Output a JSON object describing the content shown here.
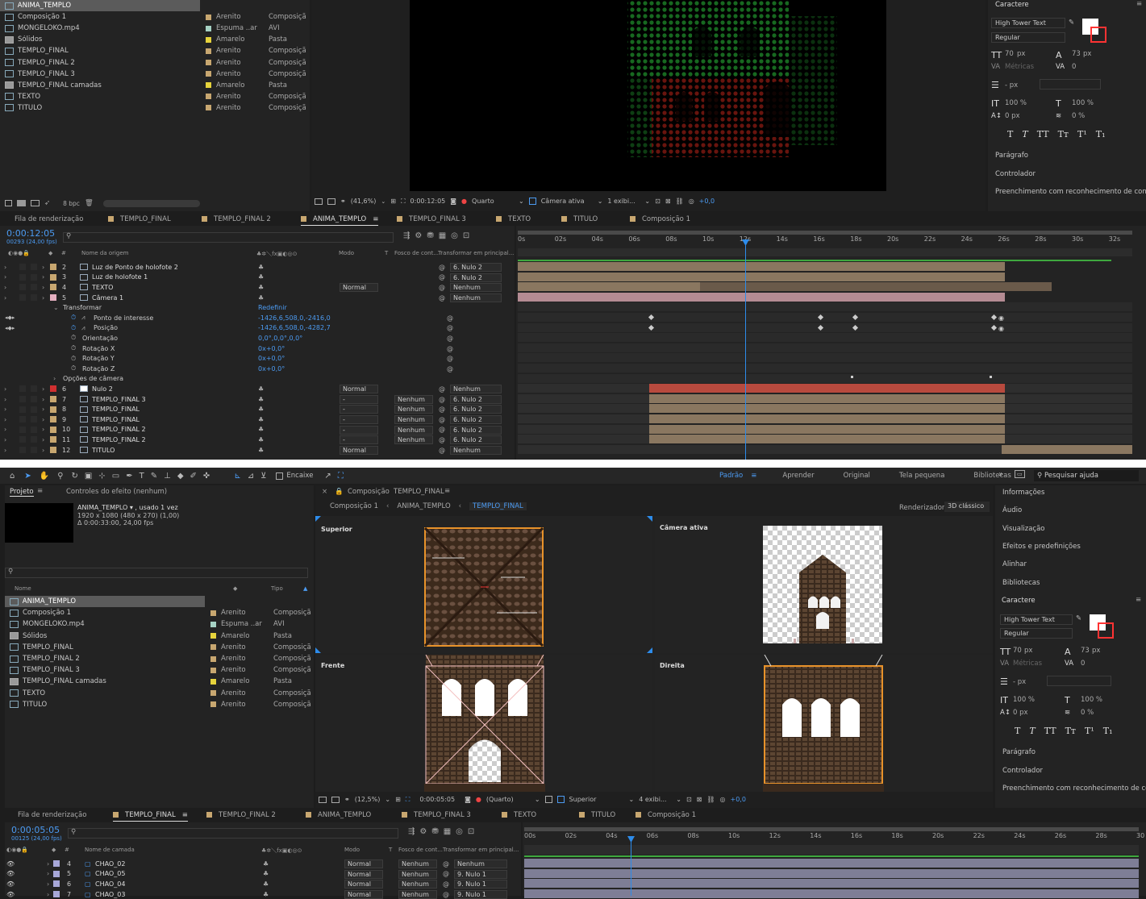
{
  "top": {
    "project_items": [
      {
        "name": "ANIMA_TEMPLO",
        "color_name": "Arenito",
        "type": "Composiçã",
        "color": "#c8a770",
        "icon": "comp-icon",
        "selected": true
      },
      {
        "name": "Composição 1",
        "color_name": "Arenito",
        "type": "Composiçã",
        "color": "#c8a770",
        "icon": "comp-icon"
      },
      {
        "name": "MONGELOKO.mp4",
        "color_name": "Espuma ..ar",
        "type": "AVI",
        "color": "#a6d2c4",
        "icon": "video-file-icon"
      },
      {
        "name": "Sólidos",
        "color_name": "Amarelo",
        "type": "Pasta",
        "color": "#e6d33c",
        "icon": "folder-icon"
      },
      {
        "name": "TEMPLO_FINAL",
        "color_name": "Arenito",
        "type": "Composiçã",
        "color": "#c8a770",
        "icon": "comp-icon"
      },
      {
        "name": "TEMPLO_FINAL 2",
        "color_name": "Arenito",
        "type": "Composiçã",
        "color": "#c8a770",
        "icon": "comp-icon"
      },
      {
        "name": "TEMPLO_FINAL 3",
        "color_name": "Arenito",
        "type": "Composiçã",
        "color": "#c8a770",
        "icon": "comp-icon"
      },
      {
        "name": "TEMPLO_FINAL camadas",
        "color_name": "Amarelo",
        "type": "Pasta",
        "color": "#e6d33c",
        "icon": "folder-icon"
      },
      {
        "name": "TEXTO",
        "color_name": "Arenito",
        "type": "Composiçã",
        "color": "#c8a770",
        "icon": "comp-icon"
      },
      {
        "name": "TITULO",
        "color_name": "Arenito",
        "type": "Composiçã",
        "color": "#c8a770",
        "icon": "comp-icon"
      }
    ],
    "bpc": "8 bpc",
    "viewer_bar": {
      "zoom": "(41,6%)",
      "timecode": "0:00:12:05",
      "resolution": "Quarto",
      "camera": "Câmera ativa",
      "views": "1 exibi...",
      "exposure": "+0,0"
    },
    "character": {
      "title": "Caractere",
      "font": "High Tower Text",
      "style": "Regular",
      "size": "70",
      "size_unit": "px",
      "leading": "73",
      "leading_unit": "px",
      "kerning": "Métricas",
      "tracking": "0",
      "line_unit": "- px",
      "vscale": "100 %",
      "hscale": "100 %",
      "baseline": "0 px",
      "tsume": "0 %"
    },
    "side_panels": [
      "Parágrafo",
      "Controlador",
      "Preenchimento com reconhecimento de conteú"
    ],
    "tabs": [
      "Fila de renderização",
      "TEMPLO_FINAL",
      "TEMPLO_FINAL 2",
      "ANIMA_TEMPLO",
      "TEMPLO_FINAL 3",
      "TEXTO",
      "TITULO",
      "Composição 1"
    ],
    "active_tab": "ANIMA_TEMPLO",
    "timecode": "0:00:12:05",
    "frames": "00293 (24,00 fps)",
    "col_headers": {
      "source": "Nome da origem",
      "mode": "Modo",
      "t": "T",
      "track": "Fosco de cont...",
      "parent": "Transformar em principal..."
    },
    "ruler": [
      "0s",
      "02s",
      "04s",
      "06s",
      "08s",
      "10s",
      "12s",
      "14s",
      "16s",
      "18s",
      "20s",
      "22s",
      "24s",
      "26s",
      "28s",
      "30s",
      "32s"
    ],
    "layers": [
      {
        "num": "2",
        "name": "Luz de Ponto de holofote 2",
        "color": "#c8a770",
        "icon": "light-icon",
        "parent": "6. Nulo 2"
      },
      {
        "num": "3",
        "name": "Luz de holofote 1",
        "color": "#c8a770",
        "icon": "light-icon",
        "parent": "6. Nulo 2"
      },
      {
        "num": "4",
        "name": "TEXTO",
        "color": "#c8a770",
        "icon": "comp-icon",
        "mode": "Normal",
        "parent": "Nenhum"
      },
      {
        "num": "5",
        "name": "Câmera 1",
        "color": "#e5b0c0",
        "icon": "camera-icon",
        "parent": "Nenhum"
      }
    ],
    "transform_label": "Transformar",
    "reset_label": "Redefinir",
    "props": [
      {
        "name": "Ponto de interesse",
        "value": "-1426,6,508,0,-2416,0"
      },
      {
        "name": "Posição",
        "value": "-1426,6,508,0,-4282,7"
      },
      {
        "name": "Orientação",
        "value": "0,0°,0,0°,0,0°"
      },
      {
        "name": "Rotação X",
        "value": "0x+0,0°"
      },
      {
        "name": "Rotação Y",
        "value": "0x+0,0°"
      },
      {
        "name": "Rotação Z",
        "value": "0x+0,0°"
      }
    ],
    "camera_options": "Opções de câmera",
    "layers2": [
      {
        "num": "6",
        "name": "Nulo 2",
        "color": "#d03030",
        "icon": "null-icon",
        "mode": "Normal",
        "track": "",
        "parent": "Nenhum"
      },
      {
        "num": "7",
        "name": "TEMPLO_FINAL 3",
        "color": "#c8a770",
        "icon": "comp-icon",
        "mode": "-",
        "track": "Nenhum",
        "parent": "6. Nulo 2"
      },
      {
        "num": "8",
        "name": "TEMPLO_FINAL",
        "color": "#c8a770",
        "icon": "comp-icon",
        "mode": "-",
        "track": "Nenhum",
        "parent": "6. Nulo 2"
      },
      {
        "num": "9",
        "name": "TEMPLO_FINAL",
        "color": "#c8a770",
        "icon": "comp-icon",
        "mode": "-",
        "track": "Nenhum",
        "parent": "6. Nulo 2"
      },
      {
        "num": "10",
        "name": "TEMPLO_FINAL 2",
        "color": "#c8a770",
        "icon": "comp-icon",
        "mode": "-",
        "track": "Nenhum",
        "parent": "6. Nulo 2"
      },
      {
        "num": "11",
        "name": "TEMPLO_FINAL 2",
        "color": "#c8a770",
        "icon": "comp-icon",
        "mode": "-",
        "track": "Nenhum",
        "parent": "6. Nulo 2"
      },
      {
        "num": "12",
        "name": "TITULO",
        "color": "#c8a770",
        "icon": "comp-icon",
        "mode": "Normal",
        "track": "",
        "parent": "Nenhum"
      }
    ]
  },
  "bottom": {
    "toolbar": {
      "snap": "Encaixe",
      "workspaces": [
        "Padrão",
        "Aprender",
        "Original",
        "Tela pequena",
        "Bibliotecas"
      ],
      "active_workspace": "Padrão",
      "search": "Pesquisar ajuda"
    },
    "project_tab": "Projeto",
    "effects_tab": "Controles do efeito (nenhum)",
    "selected_comp": "ANIMA_TEMPLO ▾ , usado 1 vez",
    "comp_size": "1920 x 1080  (480 x 270) (1,00)",
    "comp_duration": "Δ 0:00:33:00, 24,00 fps",
    "col_name": "Nome",
    "col_type": "Tipo",
    "comp_title": "Composição",
    "comp_name": "TEMPLO_FINAL",
    "crumbs": [
      "Composição 1",
      "ANIMA_TEMPLO",
      "TEMPLO_FINAL"
    ],
    "renderer_label": "Renderizador:",
    "renderer": "3D clássico",
    "view_labels": [
      "Superior",
      "Câmera ativa",
      "Frente",
      "Direita"
    ],
    "viewer_bar": {
      "zoom": "(12,5%)",
      "timecode": "0:00:05:05",
      "resolution": "(Quarto)",
      "view": "Superior",
      "views": "4 exibi...",
      "exposure": "+0,0"
    },
    "right_panels": [
      "Informações",
      "Áudio",
      "Visualização",
      "Efeitos e predefinições",
      "Alinhar",
      "Bibliotecas"
    ],
    "side_panels": [
      "Parágrafo",
      "Controlador",
      "Preenchimento com reconhecimento de conte"
    ],
    "tabs": [
      "Fila de renderização",
      "TEMPLO_FINAL",
      "TEMPLO_FINAL 2",
      "ANIMA_TEMPLO",
      "TEMPLO_FINAL 3",
      "TEXTO",
      "TITULO",
      "Composição 1"
    ],
    "timecode": "0:00:05:05",
    "frames": "00125 (24,00 fps)",
    "col_headers": {
      "layer": "Nome de camada",
      "mode": "Modo",
      "t": "T",
      "track": "Fosco de cont...",
      "parent": "Transformar em principal..."
    },
    "ruler": [
      "00s",
      "02s",
      "04s",
      "06s",
      "08s",
      "10s",
      "12s",
      "14s",
      "16s",
      "18s",
      "20s",
      "22s",
      "24s",
      "26s",
      "28s",
      "30"
    ],
    "layers": [
      {
        "num": "4",
        "name": "CHAO_02",
        "mode": "Normal",
        "track": "Nenhum",
        "parent": "Nenhum"
      },
      {
        "num": "5",
        "name": "CHAO_05",
        "mode": "Normal",
        "track": "Nenhum",
        "parent": "9. Nulo 1"
      },
      {
        "num": "6",
        "name": "CHAO_04",
        "mode": "Normal",
        "track": "Nenhum",
        "parent": "9. Nulo 1"
      },
      {
        "num": "7",
        "name": "CHAO_03",
        "mode": "Normal",
        "track": "Nenhum",
        "parent": "9. Nulo 1"
      }
    ]
  }
}
